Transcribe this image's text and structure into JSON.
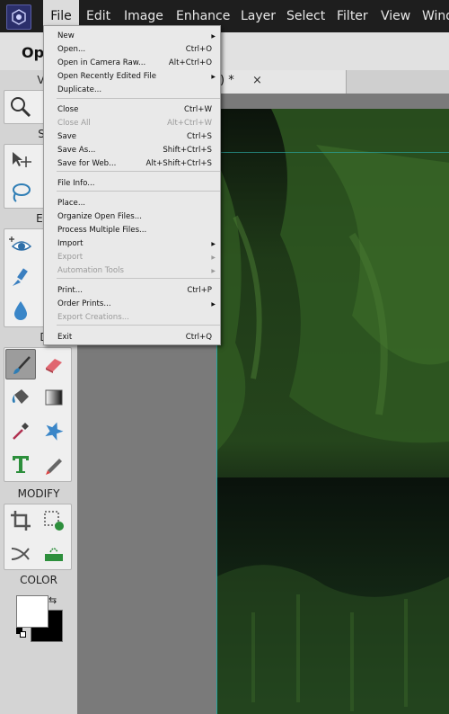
{
  "menubar": {
    "items": [
      "File",
      "Edit",
      "Image",
      "Enhance",
      "Layer",
      "Select",
      "Filter",
      "View",
      "Wind"
    ],
    "active": "File"
  },
  "second_bar": {
    "mode_label": "Op"
  },
  "toolbox": {
    "sections": {
      "view": "VIEW",
      "select": "SELE",
      "enhance": "ENHA",
      "draw": "DRA",
      "modify": "MODIFY",
      "color": "COLOR"
    },
    "tools": {
      "view": [
        "zoom-icon"
      ],
      "select": [
        "move-icon",
        "lasso-icon"
      ],
      "enhance": [
        "eye-icon",
        "healing-brush-icon",
        "blur-drop-icon"
      ],
      "draw": [
        "brush-icon",
        "eraser-icon",
        "paint-bucket-icon",
        "gradient-icon",
        "eyedropper-icon",
        "custom-shape-icon",
        "type-icon",
        "pencil-icon"
      ],
      "modify": [
        "crop-icon",
        "recompose-icon",
        "straighten-icon",
        "content-move-icon"
      ]
    },
    "colors": {
      "foreground": "#ffffff",
      "background": "#000000"
    }
  },
  "document_tab": {
    "title_suffix": ") *",
    "close": "×"
  },
  "file_menu": {
    "items": [
      {
        "label": "New",
        "shortcut": "",
        "submenu": true,
        "disabled": false
      },
      {
        "label": "Open...",
        "shortcut": "Ctrl+O",
        "submenu": false,
        "disabled": false
      },
      {
        "label": "Open in Camera Raw...",
        "shortcut": "Alt+Ctrl+O",
        "submenu": false,
        "disabled": false
      },
      {
        "label": "Open Recently Edited File",
        "shortcut": "",
        "submenu": true,
        "disabled": false
      },
      {
        "label": "Duplicate...",
        "shortcut": "",
        "submenu": false,
        "disabled": false
      },
      {
        "label": "Close",
        "shortcut": "Ctrl+W",
        "submenu": false,
        "disabled": false
      },
      {
        "label": "Close All",
        "shortcut": "Alt+Ctrl+W",
        "submenu": false,
        "disabled": true
      },
      {
        "label": "Save",
        "shortcut": "Ctrl+S",
        "submenu": false,
        "disabled": false
      },
      {
        "label": "Save As...",
        "shortcut": "Shift+Ctrl+S",
        "submenu": false,
        "disabled": false
      },
      {
        "label": "Save for Web...",
        "shortcut": "Alt+Shift+Ctrl+S",
        "submenu": false,
        "disabled": false
      },
      {
        "label": "File Info...",
        "shortcut": "",
        "submenu": false,
        "disabled": false
      },
      {
        "label": "Place...",
        "shortcut": "",
        "submenu": false,
        "disabled": false
      },
      {
        "label": "Organize Open Files...",
        "shortcut": "",
        "submenu": false,
        "disabled": false
      },
      {
        "label": "Process Multiple Files...",
        "shortcut": "",
        "submenu": false,
        "disabled": false
      },
      {
        "label": "Import",
        "shortcut": "",
        "submenu": true,
        "disabled": false
      },
      {
        "label": "Export",
        "shortcut": "",
        "submenu": true,
        "disabled": true
      },
      {
        "label": "Automation Tools",
        "shortcut": "",
        "submenu": true,
        "disabled": true
      },
      {
        "label": "Print...",
        "shortcut": "Ctrl+P",
        "submenu": false,
        "disabled": false
      },
      {
        "label": "Order Prints...",
        "shortcut": "",
        "submenu": true,
        "disabled": false
      },
      {
        "label": "Export Creations...",
        "shortcut": "",
        "submenu": false,
        "disabled": true
      },
      {
        "label": "Exit",
        "shortcut": "Ctrl+Q",
        "submenu": false,
        "disabled": false
      }
    ]
  }
}
